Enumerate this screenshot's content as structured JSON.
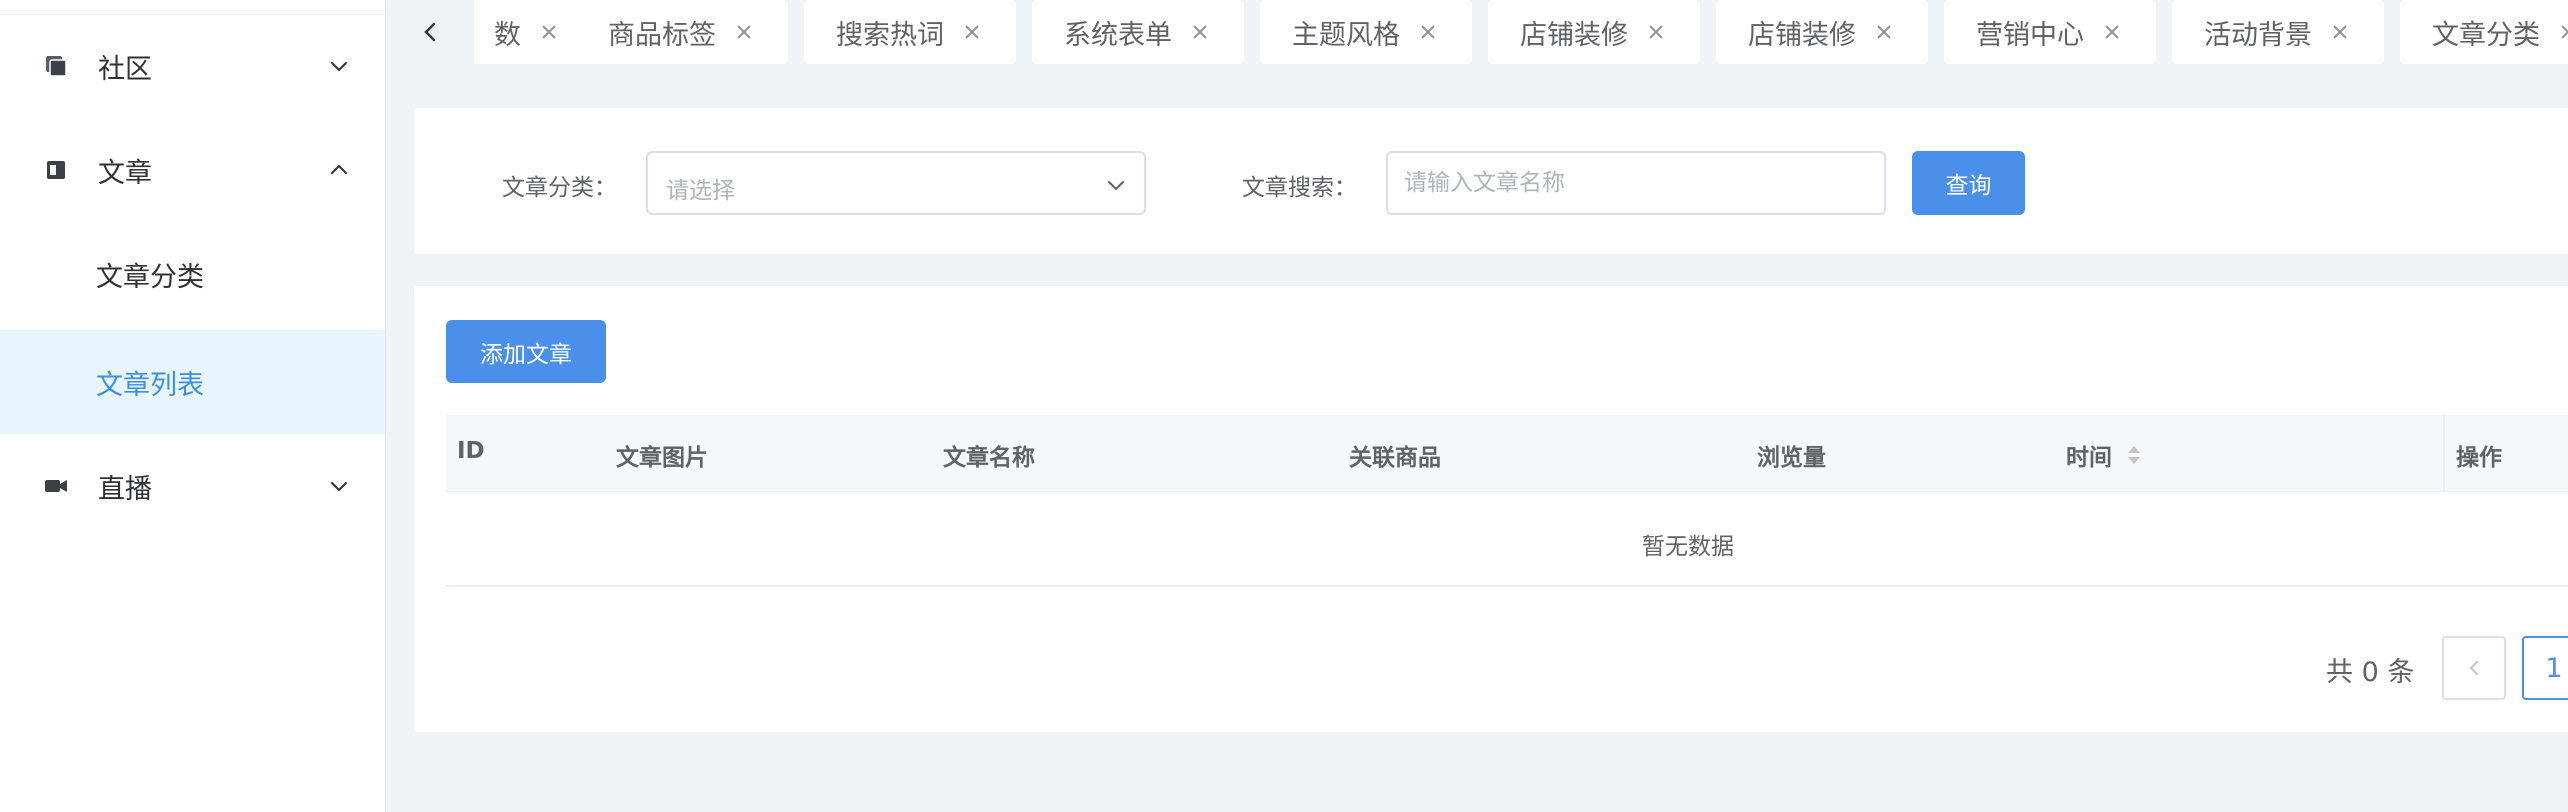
{
  "sidebar": {
    "items": [
      {
        "label": "社区",
        "icon": "community-icon",
        "expanded": false
      },
      {
        "label": "文章",
        "icon": "article-icon",
        "expanded": true,
        "children": [
          {
            "label": "文章分类",
            "active": false
          },
          {
            "label": "文章列表",
            "active": true
          }
        ]
      },
      {
        "label": "直播",
        "icon": "video-camera-icon",
        "expanded": false
      }
    ]
  },
  "tabs": [
    {
      "label": "数"
    },
    {
      "label": "商品标签"
    },
    {
      "label": "搜索热词"
    },
    {
      "label": "系统表单"
    },
    {
      "label": "主题风格"
    },
    {
      "label": "店铺装修"
    },
    {
      "label": "店铺装修"
    },
    {
      "label": "营销中心"
    },
    {
      "label": "活动背景"
    },
    {
      "label": "文章分类"
    }
  ],
  "filter": {
    "category_label": "文章分类：",
    "category_placeholder": "请选择",
    "search_label": "文章搜索：",
    "search_placeholder": "请输入文章名称",
    "search_value": "",
    "query_button": "查询"
  },
  "table": {
    "add_button": "添加文章",
    "columns": [
      "ID",
      "文章图片",
      "文章名称",
      "关联商品",
      "浏览量",
      "时间",
      "操作"
    ],
    "rows": [],
    "empty_text": "暂无数据"
  },
  "pagination": {
    "total_text": "共 0 条",
    "current_page": "1"
  },
  "colors": {
    "primary": "#4a8fe9",
    "active_menu_bg": "#e8f4ff",
    "active_menu_text": "#3a8ee6"
  }
}
